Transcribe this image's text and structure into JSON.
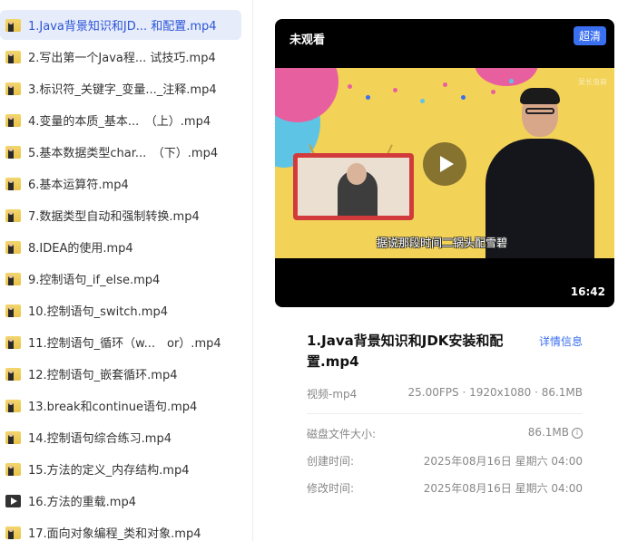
{
  "files": [
    {
      "name": "1.Java背景知识和JD... 和配置.mp4",
      "selected": true,
      "thumb": "presenter"
    },
    {
      "name": "2.写出第一个Java程... 试技巧.mp4",
      "thumb": "presenter"
    },
    {
      "name": "3.标识符_关键字_变量..._注释.mp4",
      "thumb": "presenter"
    },
    {
      "name": "4.变量的本质_基本...　（上）.mp4",
      "thumb": "presenter"
    },
    {
      "name": "5.基本数据类型char...　（下）.mp4",
      "thumb": "presenter"
    },
    {
      "name": "6.基本运算符.mp4",
      "thumb": "presenter"
    },
    {
      "name": "7.数据类型自动和强制转换.mp4",
      "thumb": "presenter"
    },
    {
      "name": "8.IDEA的使用.mp4",
      "thumb": "presenter"
    },
    {
      "name": "9.控制语句_if_else.mp4",
      "thumb": "presenter"
    },
    {
      "name": "10.控制语句_switch.mp4",
      "thumb": "presenter"
    },
    {
      "name": "11.控制语句_循环（w...　or）.mp4",
      "thumb": "presenter"
    },
    {
      "name": "12.控制语句_嵌套循环.mp4",
      "thumb": "presenter"
    },
    {
      "name": "13.break和continue语句.mp4",
      "thumb": "presenter"
    },
    {
      "name": "14.控制语句综合练习.mp4",
      "thumb": "presenter"
    },
    {
      "name": "15.方法的定义_内存结构.mp4",
      "thumb": "presenter"
    },
    {
      "name": "16.方法的重载.mp4",
      "thumb": "dark"
    },
    {
      "name": "17.面向对象编程_类和对象.mp4",
      "thumb": "presenter"
    }
  ],
  "player": {
    "watch_state": "未观看",
    "quality": "超清",
    "subtitle": "据说那段时间二锅头配雪碧",
    "watermark": "吴长虫商",
    "duration": "16:42"
  },
  "details": {
    "title": "1.Java背景知识和JDK安装和配置.mp4",
    "link": "详情信息",
    "type": "视频-mp4",
    "spec": "25.00FPS · 1920x1080 · 86.1MB",
    "rows": [
      {
        "label": "磁盘文件大小:",
        "value": "86.1MB",
        "info": true
      },
      {
        "label": "创建时间:",
        "value": "2025年08月16日 星期六 04:00"
      },
      {
        "label": "修改时间:",
        "value": "2025年08月16日 星期六 04:00"
      }
    ]
  },
  "colors": {
    "accent": "#3a6ff0",
    "selected_bg": "#e7ecfb"
  }
}
